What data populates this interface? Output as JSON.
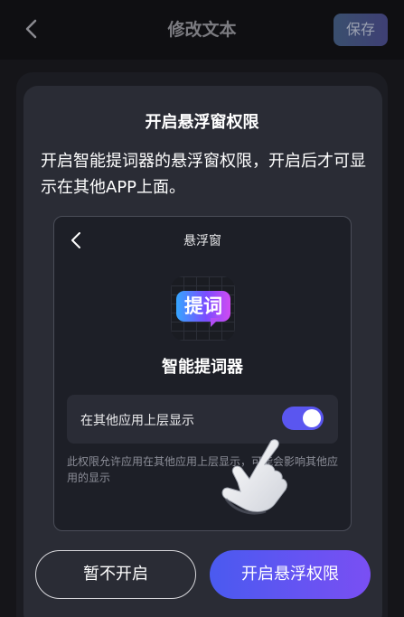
{
  "header": {
    "title": "修改文本",
    "save_label": "保存"
  },
  "dialog": {
    "title": "开启悬浮窗权限",
    "description": "开启智能提词器的悬浮窗权限，开启后才可显示在其他APP上面。",
    "cancel_label": "暂不开启",
    "confirm_label": "开启悬浮权限"
  },
  "illustration": {
    "title": "悬浮窗",
    "app_icon_text": "提词",
    "app_name": "智能提词器",
    "toggle_label": "在其他应用上层显示",
    "toggle_on": true,
    "note": "此权限允许应用在其他应用上层显示，可能会影响其他应用的显示"
  },
  "colors": {
    "accent": "#5a56f0",
    "confirm_start": "#4a5af0",
    "confirm_end": "#7a4ff3"
  }
}
